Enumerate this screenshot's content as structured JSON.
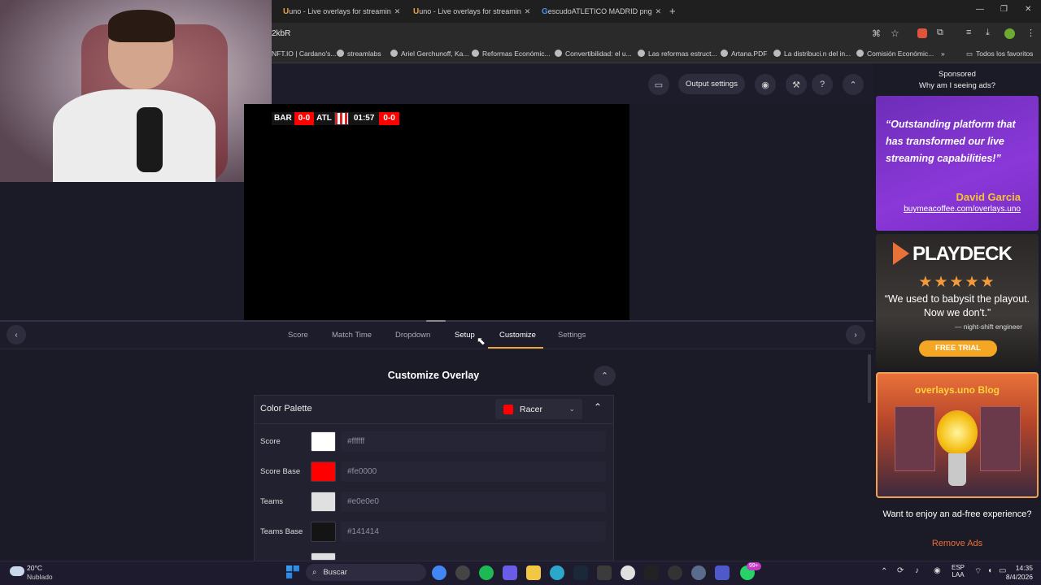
{
  "browser": {
    "tabs": [
      {
        "title": "uno - Live overlays for streamin"
      },
      {
        "title": "uno - Live overlays for streamin"
      },
      {
        "title": "escudoATLETICO MADRID png"
      }
    ],
    "url_fragment": "2kbR",
    "bookmarks": [
      "NFT.IO | Cardano's...",
      "streamlabs",
      "Ariel Gerchunoff, Ka...",
      "Reformas Económic...",
      "Convertibilidad: el u...",
      "Las reformas estruct...",
      "Artana.PDF",
      "La distribuci.n del in...",
      "Comisión Económic..."
    ],
    "all_bookmarks": "Todos los favoritos"
  },
  "app_header": {
    "output_settings": "Output settings"
  },
  "scorebug": {
    "home": "BAR",
    "home_score": "0-0",
    "away": "ATL",
    "time": "01:57",
    "extra_score": "0-0"
  },
  "nav_tabs": [
    "Score",
    "Match Time",
    "Dropdown",
    "Setup",
    "Customize",
    "Settings"
  ],
  "active_tab": "Customize",
  "customize": {
    "title": "Customize Overlay",
    "palette_label": "Color Palette",
    "palette_value": "Racer",
    "rows": [
      {
        "label": "Score",
        "hex": "#ffffff",
        "color": "#ffffff"
      },
      {
        "label": "Score Base",
        "hex": "#fe0000",
        "color": "#fe0000"
      },
      {
        "label": "Teams",
        "hex": "#e0e0e0",
        "color": "#e0e0e0"
      },
      {
        "label": "Teams Base",
        "hex": "#141414",
        "color": "#141414"
      }
    ]
  },
  "ads": {
    "sponsored": "Sponsored",
    "why": "Why am I seeing ads?",
    "ad1_quote": "“Outstanding platform that has transformed our live streaming capabilities!”",
    "ad1_name": "David Garcia",
    "ad1_link": "buymeacoffee.com/overlays.uno",
    "ad2_brand": "PLAYDECK",
    "ad2_stars": "★★★★★",
    "ad2_quote": "“We used to babysit the playout. Now we don't.”",
    "ad2_attrib": "— night-shift engineer",
    "ad2_cta": "FREE TRIAL",
    "ad3_title": "overlays.uno Blog",
    "adfree": "Want to enjoy an ad-free experience?",
    "remove_ads": "Remove Ads"
  },
  "taskbar": {
    "weather_temp": "20°C",
    "weather_desc": "Nublado",
    "search": "Buscar",
    "lang1": "ESP",
    "lang2": "LAA",
    "time": "14:35",
    "date": "8/4/2026",
    "badge": "99+"
  },
  "colors": {
    "accent": "#e8a33c",
    "score_base": "#fe0000",
    "ad_purple": "#8a38d8"
  }
}
